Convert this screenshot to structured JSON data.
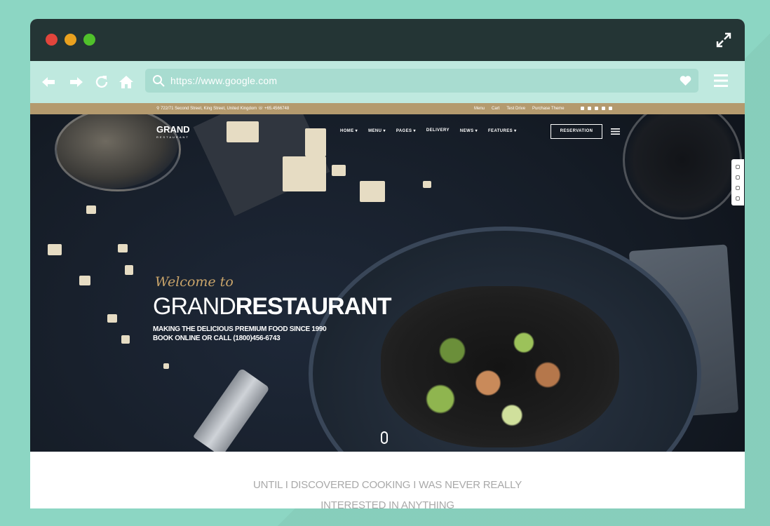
{
  "browser": {
    "url": "https://www.google.com"
  },
  "site": {
    "topbar": {
      "address": "722/71 Second Street, King Street, United Kingdom",
      "phone": "+65.4566748",
      "links": [
        "Menu",
        "Cart",
        "Test Drive",
        "Purchase Theme"
      ]
    },
    "brand": {
      "name": "GRAND",
      "tagline": "RESTAURANT"
    },
    "nav": [
      {
        "label": "HOME",
        "dropdown": true
      },
      {
        "label": "MENU",
        "dropdown": true
      },
      {
        "label": "PAGES",
        "dropdown": true
      },
      {
        "label": "DELIVERY",
        "dropdown": false
      },
      {
        "label": "NEWS",
        "dropdown": true
      },
      {
        "label": "FEATURES",
        "dropdown": true
      }
    ],
    "reservation_label": "RESERVATION",
    "hero": {
      "welcome": "Welcome to",
      "title_light": "GRAND",
      "title_bold": "RESTAURANT",
      "subtitle_line1": "MAKING THE DELICIOUS PREMIUM FOOD SINCE 1990",
      "subtitle_line2": "BOOK ONLINE OR CALL (1800)456-6743"
    },
    "intro": {
      "line1": "UNTIL I DISCOVERED COOKING I WAS NEVER REALLY",
      "line2": "INTERESTED IN ANYTHING"
    }
  },
  "colors": {
    "page_bg": "#8cd6c3",
    "titlebar": "#243535",
    "toolbar": "#bfe9df",
    "address_bar": "#a8dcd0",
    "topbar_gold": "#b49a6e",
    "welcome_gold": "#c9a46a"
  },
  "icons": [
    "back-arrow-icon",
    "forward-arrow-icon",
    "reload-icon",
    "home-icon",
    "search-icon",
    "heart-icon",
    "hamburger-menu-icon",
    "expand-icon"
  ]
}
